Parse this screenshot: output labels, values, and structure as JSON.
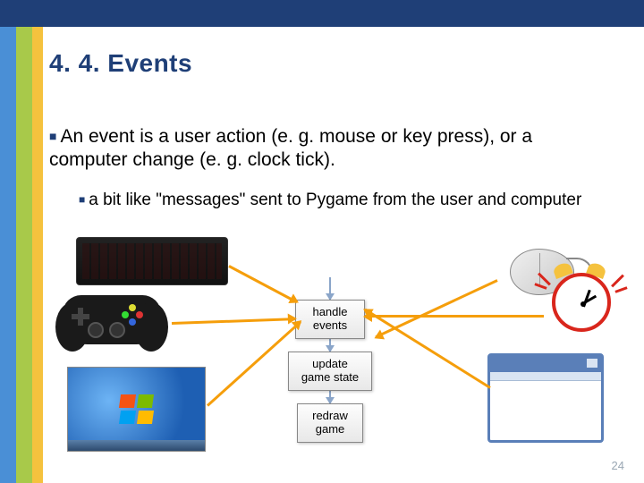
{
  "title": "4. 4. Events",
  "bullets": {
    "main": "An event is a user action (e. g. mouse or key press), or a computer change (e. g. clock tick).",
    "sub": "a bit like \"messages\" sent to Pygame from the user and computer"
  },
  "flow": {
    "handle": "handle events",
    "update": "update game state",
    "redraw": "redraw game"
  },
  "page_number": "24"
}
